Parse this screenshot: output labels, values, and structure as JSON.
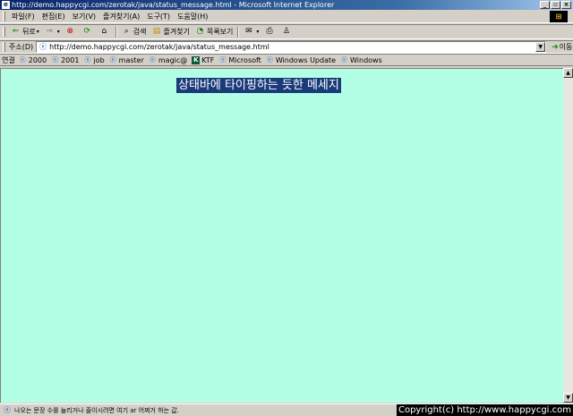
{
  "window": {
    "title": "http://demo.happycgi.com/zerotak/java/status_message.html - Microsoft Internet Explorer",
    "min_label": "_",
    "max_label": "▫",
    "close_label": "×"
  },
  "menu": {
    "items": [
      "파일(F)",
      "편집(E)",
      "보기(V)",
      "즐겨찾기(A)",
      "도구(T)",
      "도움말(H)"
    ]
  },
  "toolbar": {
    "back_label": "뒤로",
    "search_label": "검색",
    "favorites_label": "즐겨찾기",
    "history_label": "목록보기"
  },
  "address": {
    "label": "주소(D)",
    "url": "http://demo.happycgi.com/zerotak/java/status_message.html",
    "go_label": "이동"
  },
  "links": {
    "label": "연결",
    "items": [
      "2000",
      "2001",
      "job",
      "master",
      "magic@",
      "KTF",
      "Microsoft",
      "Windows Update",
      "Windows"
    ]
  },
  "content": {
    "heading": "상태바에 타이핑하는 듯한 메세지",
    "background": "#b3ffe6",
    "heading_background": "#1a3a7a"
  },
  "status": {
    "text": "나오는 문장 수를 늘리거나 줄이시려면 여기 ar 어쩌거 하는 값.",
    "copyright": "Copyright(c) http://www.happycgi.com"
  }
}
